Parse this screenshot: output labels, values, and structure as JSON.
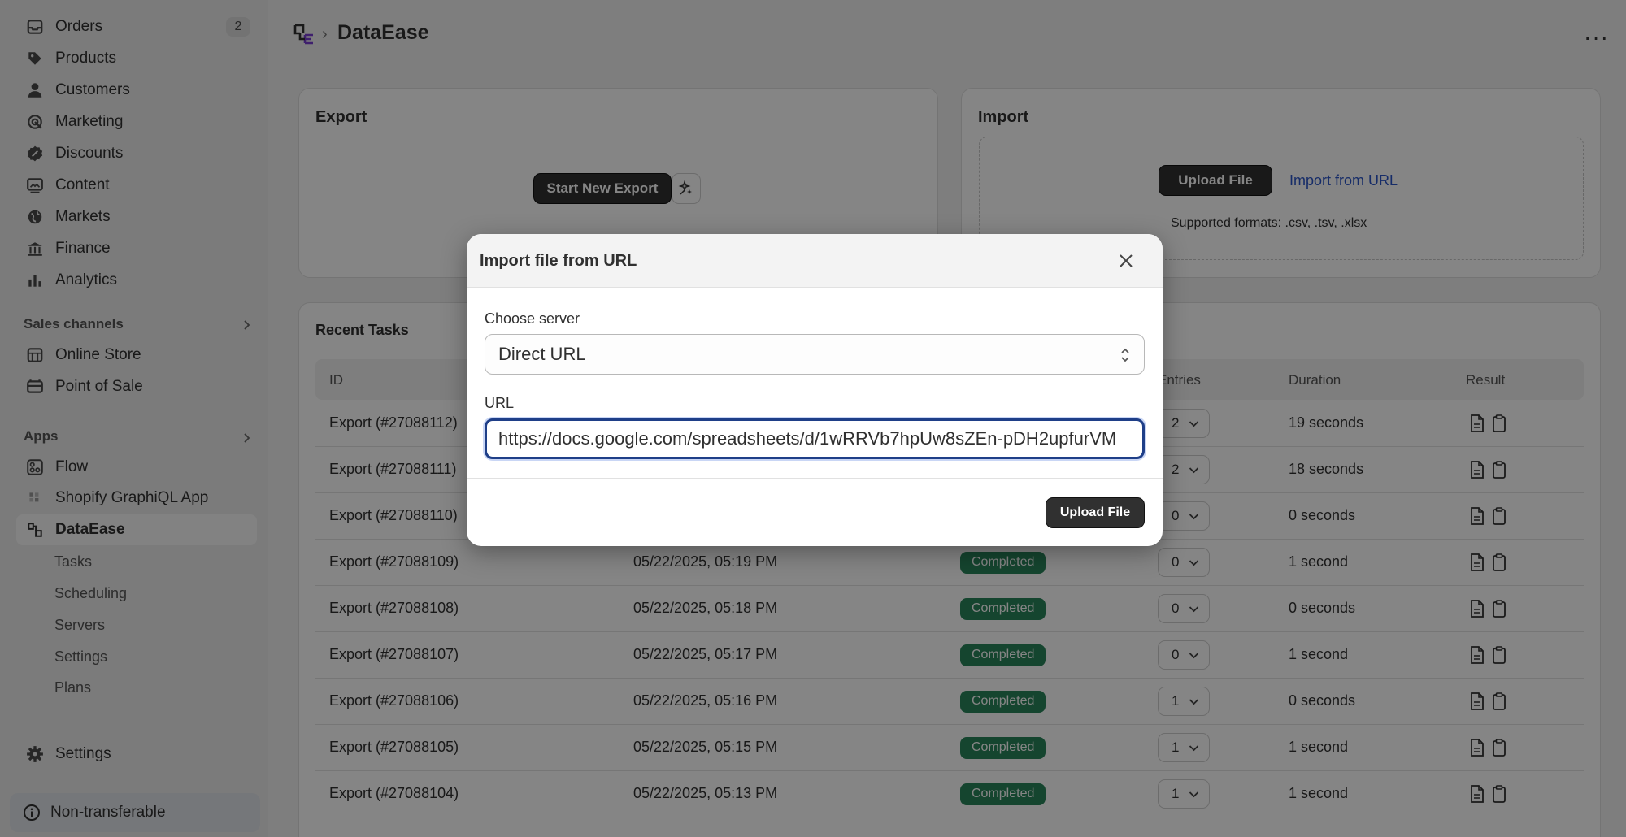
{
  "sidebar": {
    "items": [
      {
        "label": "Orders",
        "badge": "2",
        "icon": "inbox-icon"
      },
      {
        "label": "Products",
        "icon": "tag-icon"
      },
      {
        "label": "Customers",
        "icon": "person-icon"
      },
      {
        "label": "Marketing",
        "icon": "target-icon"
      },
      {
        "label": "Discounts",
        "icon": "discount-icon"
      },
      {
        "label": "Content",
        "icon": "image-icon"
      },
      {
        "label": "Markets",
        "icon": "globe-icon"
      },
      {
        "label": "Finance",
        "icon": "bank-icon"
      },
      {
        "label": "Analytics",
        "icon": "bar-chart-icon"
      }
    ],
    "sales_channels_title": "Sales channels",
    "sales_channels": [
      {
        "label": "Online Store",
        "icon": "store-icon"
      },
      {
        "label": "Point of Sale",
        "icon": "pos-icon"
      }
    ],
    "apps_title": "Apps",
    "apps": [
      {
        "label": "Flow",
        "icon": "flow-icon"
      },
      {
        "label": "Shopify GraphiQL App",
        "icon": "graphiql-icon"
      },
      {
        "label": "DataEase",
        "icon": "dataease-icon"
      }
    ],
    "dataease_sub": [
      "Tasks",
      "Scheduling",
      "Servers",
      "Settings",
      "Plans"
    ],
    "settings_label": "Settings",
    "non_transferable": "Non-transferable"
  },
  "header": {
    "crumb_sep": "›",
    "title": "DataEase",
    "more": "···"
  },
  "export_card": {
    "title": "Export",
    "start_button": "Start New Export"
  },
  "import_card": {
    "title": "Import",
    "upload_button": "Upload File",
    "import_url_link": "Import from URL",
    "supported": "Supported formats: .csv, .tsv, .xlsx"
  },
  "recent_tasks": {
    "title": "Recent Tasks",
    "columns": [
      "ID",
      "Entries",
      "Duration",
      "Result"
    ],
    "rows": [
      {
        "id": "Export (#27088112)",
        "date": "",
        "status": "",
        "entries": "2",
        "duration": "19 seconds"
      },
      {
        "id": "Export (#27088111)",
        "date": "",
        "status": "",
        "entries": "2",
        "duration": "18 seconds"
      },
      {
        "id": "Export (#27088110)",
        "date": "",
        "status": "",
        "entries": "0",
        "duration": "0 seconds"
      },
      {
        "id": "Export (#27088109)",
        "date": "05/22/2025, 05:19 PM",
        "status": "Completed",
        "entries": "0",
        "duration": "1 second"
      },
      {
        "id": "Export (#27088108)",
        "date": "05/22/2025, 05:18 PM",
        "status": "Completed",
        "entries": "0",
        "duration": "0 seconds"
      },
      {
        "id": "Export (#27088107)",
        "date": "05/22/2025, 05:17 PM",
        "status": "Completed",
        "entries": "0",
        "duration": "1 second"
      },
      {
        "id": "Export (#27088106)",
        "date": "05/22/2025, 05:16 PM",
        "status": "Completed",
        "entries": "1",
        "duration": "0 seconds"
      },
      {
        "id": "Export (#27088105)",
        "date": "05/22/2025, 05:15 PM",
        "status": "Completed",
        "entries": "1",
        "duration": "1 second"
      },
      {
        "id": "Export (#27088104)",
        "date": "05/22/2025, 05:13 PM",
        "status": "Completed",
        "entries": "1",
        "duration": "1 second"
      }
    ]
  },
  "modal": {
    "title": "Import file from URL",
    "server_label": "Choose server",
    "server_value": "Direct URL",
    "url_label": "URL",
    "url_value": "https://docs.google.com/spreadsheets/d/1wRRVb7hpUw8sZEn-pDH2upfurVM",
    "upload_button": "Upload File"
  },
  "colors": {
    "accent_dark": "#303030",
    "link": "#2b55c8",
    "status_completed": "#29845a",
    "focus_ring": "#1f3f88"
  }
}
